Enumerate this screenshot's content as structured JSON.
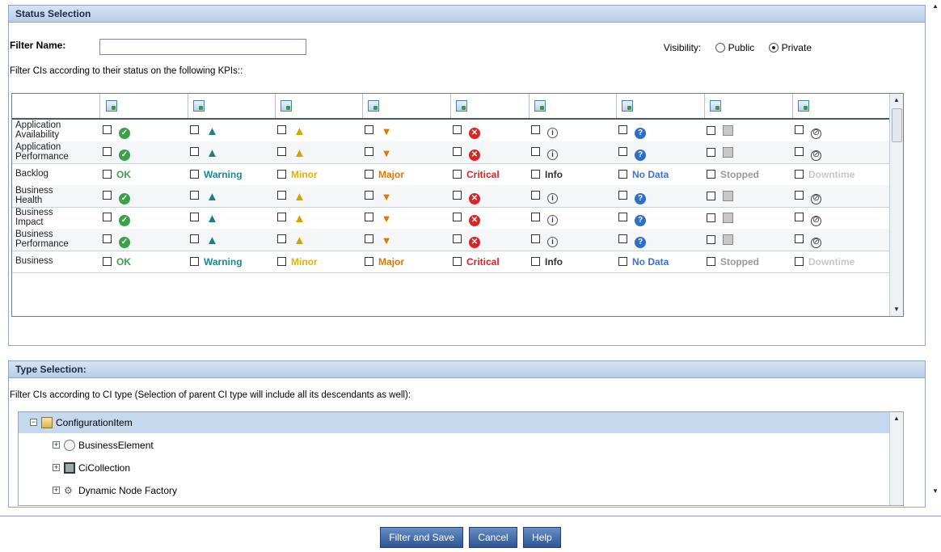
{
  "status_panel": {
    "title": "Status Selection",
    "filter_name_label": "Filter Name:",
    "filter_name_value": "",
    "visibility_label": "Visibility:",
    "visibility_public": "Public",
    "visibility_private": "Private",
    "visibility_selected": "Private",
    "kpi_description": "Filter CIs according to their status on the following KPIs::"
  },
  "kpi_columns": [
    {
      "status": "OK",
      "icon": "ok-icon",
      "color": "#3aa14a"
    },
    {
      "status": "Warning",
      "icon": "warning-icon",
      "color": "#1b8a96"
    },
    {
      "status": "Minor",
      "icon": "minor-icon",
      "color": "#e2b300"
    },
    {
      "status": "Major",
      "icon": "major-icon",
      "color": "#e07800"
    },
    {
      "status": "Critical",
      "icon": "critical-icon",
      "color": "#d92525"
    },
    {
      "status": "Info",
      "icon": "info-icon",
      "color": "#333333"
    },
    {
      "status": "No Data",
      "icon": "no-data-icon",
      "color": "#3b75c9"
    },
    {
      "status": "Stopped",
      "icon": "stopped-icon",
      "color": "#9a9a9a"
    },
    {
      "status": "Downtime",
      "icon": "downtime-icon",
      "color": "#c8c8c8"
    }
  ],
  "kpi_rows": [
    {
      "name_line1": "Application",
      "name_line2": "Availability",
      "mode": "icons"
    },
    {
      "name_line1": "Application",
      "name_line2": "Performance",
      "mode": "icons"
    },
    {
      "name_line1": "Backlog",
      "name_line2": "",
      "mode": "labels"
    },
    {
      "name_line1": "Business",
      "name_line2": "Health",
      "mode": "icons"
    },
    {
      "name_line1": "Business",
      "name_line2": "Impact",
      "mode": "icons"
    },
    {
      "name_line1": "Business",
      "name_line2": "Performance",
      "mode": "icons"
    },
    {
      "name_line1": "Business",
      "name_line2": "",
      "mode": "labels"
    }
  ],
  "type_panel": {
    "title": "Type Selection:",
    "description": "Filter CIs according to CI type (Selection of parent CI type will include all its descendants as well):",
    "tree": [
      {
        "label": "ConfigurationItem",
        "level": 0,
        "icon": "configuration-item-icon",
        "expander": "−",
        "selected": true
      },
      {
        "label": "BusinessElement",
        "level": 1,
        "icon": "business-element-icon",
        "expander": "+",
        "selected": false
      },
      {
        "label": "CiCollection",
        "level": 1,
        "icon": "ci-collection-icon",
        "expander": "+",
        "selected": false
      },
      {
        "label": "Dynamic Node Factory",
        "level": 1,
        "icon": "dynamic-node-factory-icon",
        "expander": "+",
        "selected": false
      }
    ]
  },
  "buttons": {
    "filter_and_save": "Filter and Save",
    "cancel": "Cancel",
    "help": "Help"
  }
}
